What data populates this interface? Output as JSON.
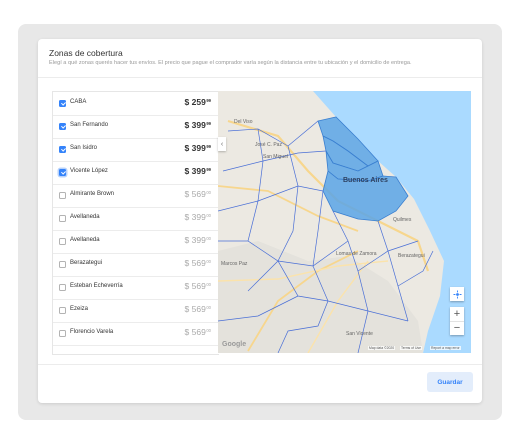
{
  "header": {
    "title": "Zonas de cobertura",
    "subtitle": "Elegí a qué zonas querés hacer tus envíos. El precio que pague el comprador varía según la distancia entre tu ubicación y el domicilio de entrega."
  },
  "zones": [
    {
      "name": "CABA",
      "price": "$ 259",
      "cents": "99",
      "checked": true
    },
    {
      "name": "San Fernando",
      "price": "$ 399",
      "cents": "99",
      "checked": true
    },
    {
      "name": "San Isidro",
      "price": "$ 399",
      "cents": "99",
      "checked": true
    },
    {
      "name": "Vicente López",
      "price": "$ 399",
      "cents": "99",
      "checked": true
    },
    {
      "name": "Almirante Brown",
      "price": "$ 569",
      "cents": "00",
      "checked": false
    },
    {
      "name": "Avellaneda",
      "price": "$ 399",
      "cents": "00",
      "checked": false
    },
    {
      "name": "Avellaneda",
      "price": "$ 399",
      "cents": "00",
      "checked": false
    },
    {
      "name": "Berazategui",
      "price": "$ 569",
      "cents": "00",
      "checked": false
    },
    {
      "name": "Esteban Echeverría",
      "price": "$ 569",
      "cents": "00",
      "checked": false
    },
    {
      "name": "Ezeiza",
      "price": "$ 569",
      "cents": "00",
      "checked": false
    },
    {
      "name": "Florencio Varela",
      "price": "$ 569",
      "cents": "00",
      "checked": false
    }
  ],
  "map": {
    "labels": {
      "del_viso": "Del Viso",
      "jose_c_paz": "José C. Paz",
      "san_miguel": "San Miguel",
      "buenos_aires": "Buenos Aires",
      "quilmes": "Quilmes",
      "marcos_paz": "Marcos Paz",
      "lomas": "Lomas de Zamora",
      "berazategui": "Berazategui",
      "san_vicente": "San Vicente"
    },
    "google": "Google",
    "map_data": "Map data ©2020",
    "terms": "Terms of Use",
    "report": "Report a map error",
    "selected_color": "#5aa4e6",
    "water_color": "#aadaff"
  },
  "footer": {
    "save_label": "Guardar"
  },
  "colors": {
    "accent": "#3483fa",
    "checkbox_checked": "#3483fa"
  }
}
